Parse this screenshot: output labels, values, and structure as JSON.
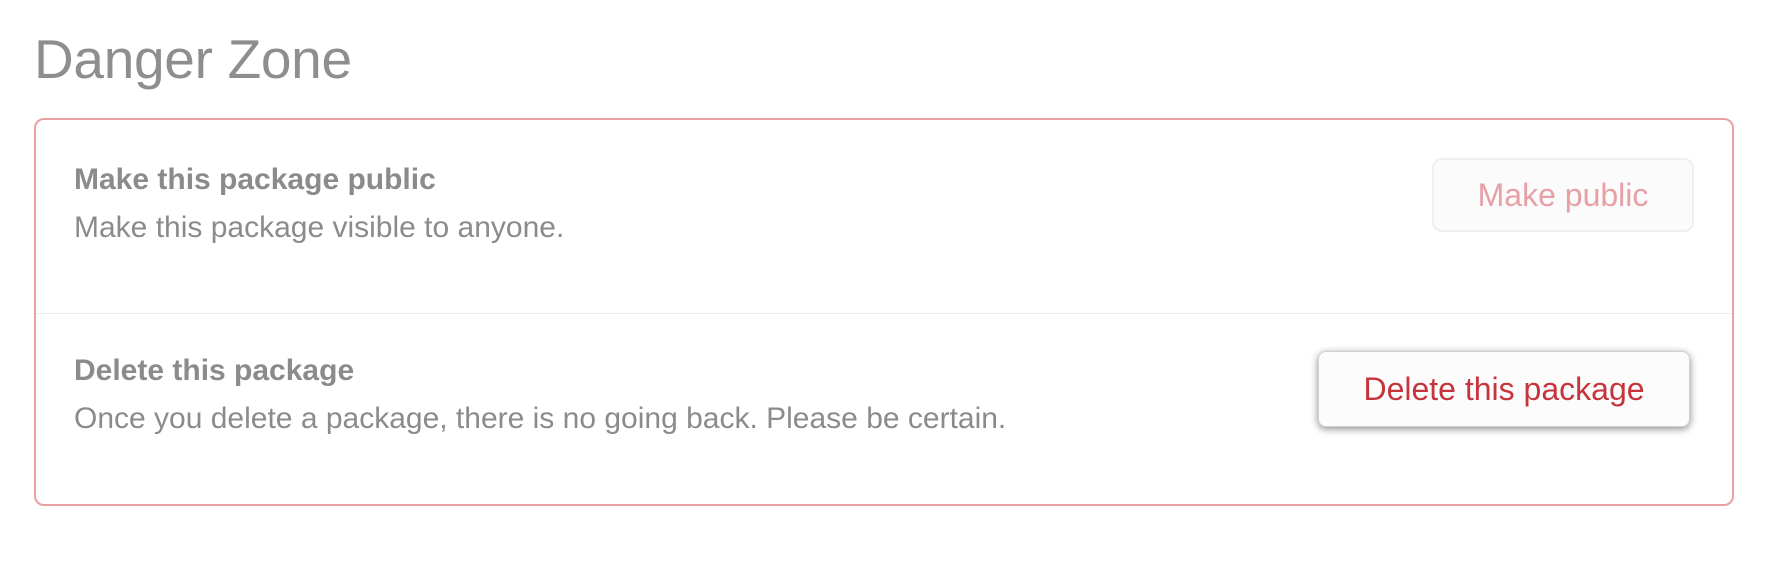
{
  "danger_zone": {
    "title": "Danger Zone",
    "accent_color": "#e9a0a4",
    "make_public": {
      "heading": "Make this package public",
      "description": "Make this package visible to anyone.",
      "button_label": "Make public"
    },
    "delete_package": {
      "heading": "Delete this package",
      "description": "Once you delete a package, there is no going back. Please be certain.",
      "button_label": "Delete this package",
      "button_color": "#c6343c"
    }
  }
}
